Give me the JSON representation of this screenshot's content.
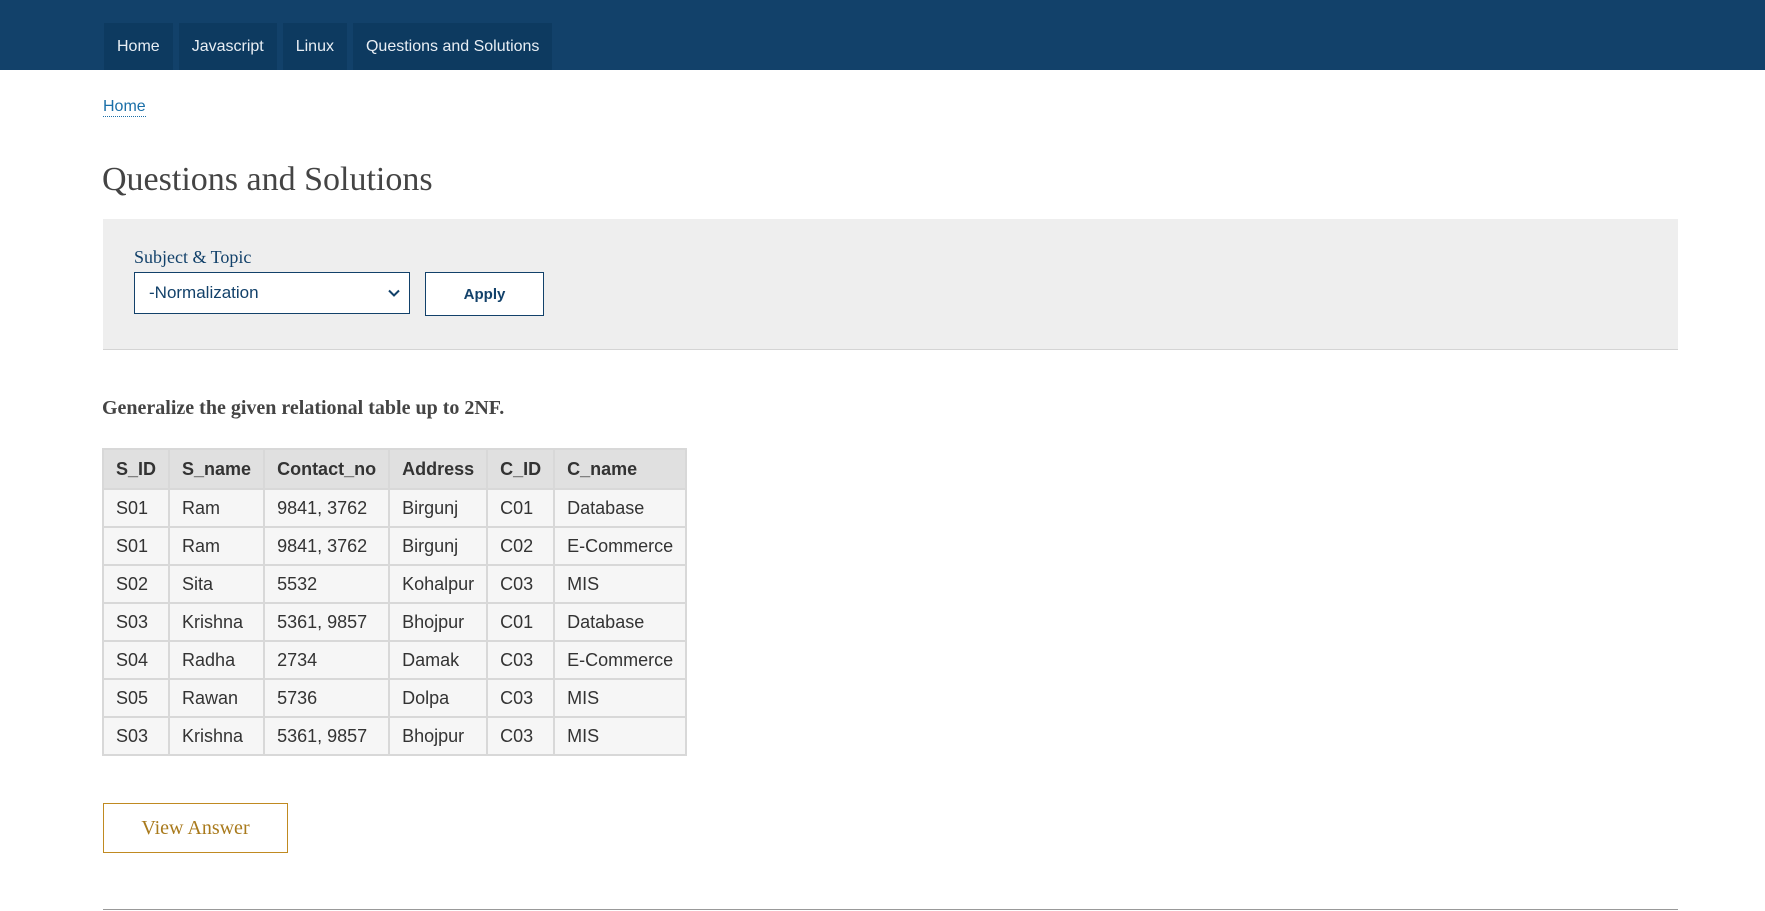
{
  "nav": {
    "items": [
      {
        "label": "Home"
      },
      {
        "label": "Javascript"
      },
      {
        "label": "Linux"
      },
      {
        "label": "Questions and Solutions"
      }
    ]
  },
  "breadcrumb": {
    "home": "Home"
  },
  "page": {
    "title": "Questions and Solutions"
  },
  "filter": {
    "label": "Subject & Topic",
    "selected": "-Normalization",
    "apply_label": "Apply"
  },
  "question": {
    "text": "Generalize the given relational table up to 2NF.",
    "columns": [
      "S_ID",
      "S_name",
      "Contact_no",
      "Address",
      "C_ID",
      "C_name"
    ],
    "rows": [
      [
        "S01",
        "Ram",
        "9841, 3762",
        "Birgunj",
        "C01",
        "Database"
      ],
      [
        "S01",
        "Ram",
        "9841, 3762",
        "Birgunj",
        "C02",
        "E-Commerce"
      ],
      [
        "S02",
        "Sita",
        "5532",
        "Kohalpur",
        "C03",
        "MIS"
      ],
      [
        "S03",
        "Krishna",
        "5361, 9857",
        "Bhojpur",
        "C01",
        "Database"
      ],
      [
        "S04",
        "Radha",
        "2734",
        "Damak",
        "C03",
        "E-Commerce"
      ],
      [
        "S05",
        "Rawan",
        "5736",
        "Dolpa",
        "C03",
        "MIS"
      ],
      [
        "S03",
        "Krishna",
        "5361, 9857",
        "Bhojpur",
        "C03",
        "MIS"
      ]
    ],
    "view_answer_label": "View Answer"
  },
  "icons": {
    "select_chevron": "chevron-down-icon"
  },
  "colors": {
    "header_bg": "#12416a",
    "nav_item_bg": "#0d3a60",
    "link": "#1a6fa8",
    "accent_gold": "#c08a21",
    "panel_bg": "#eeeeee"
  }
}
